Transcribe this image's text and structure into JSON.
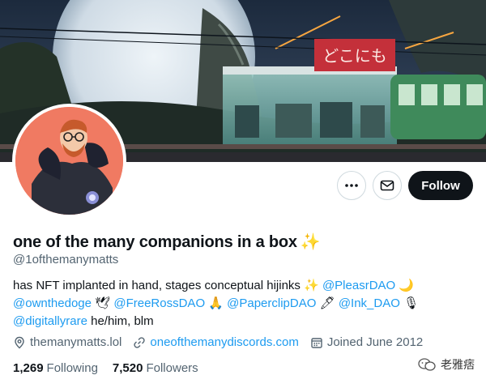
{
  "profile": {
    "display_name": "one of the many companions in a box",
    "name_emoji": "✨",
    "handle": "@1ofthemanymatts"
  },
  "actions": {
    "more_label": "More",
    "message_label": "Message",
    "follow_label": "Follow"
  },
  "banner": {
    "sign_text": "どこにも"
  },
  "bio": {
    "segments": [
      {
        "type": "text",
        "text": "has NFT implanted in hand, stages conceptual hijinks "
      },
      {
        "type": "emoji",
        "text": "✨"
      },
      {
        "type": "text",
        "text": " "
      },
      {
        "type": "mention",
        "text": "@PleasrDAO"
      },
      {
        "type": "text",
        "text": " "
      },
      {
        "type": "emoji",
        "text": "🌙"
      },
      {
        "type": "text",
        "text": " "
      },
      {
        "type": "mention",
        "text": "@ownthedoge"
      },
      {
        "type": "text",
        "text": " "
      },
      {
        "type": "emoji",
        "text": "🕊"
      },
      {
        "type": "text",
        "text": " "
      },
      {
        "type": "mention",
        "text": "@FreeRossDAO"
      },
      {
        "type": "text",
        "text": " "
      },
      {
        "type": "emoji",
        "text": "🙏"
      },
      {
        "type": "text",
        "text": " "
      },
      {
        "type": "mention",
        "text": "@PaperclipDAO"
      },
      {
        "type": "text",
        "text": " "
      },
      {
        "type": "emoji",
        "text": "🖊"
      },
      {
        "type": "text",
        "text": " "
      },
      {
        "type": "mention",
        "text": "@Ink_DAO"
      },
      {
        "type": "text",
        "text": " "
      },
      {
        "type": "emoji",
        "text": "🎙"
      },
      {
        "type": "text",
        "text": " "
      },
      {
        "type": "mention",
        "text": "@digitallyrare"
      },
      {
        "type": "text",
        "text": " he/him, blm"
      }
    ]
  },
  "meta": {
    "location": "themanymatts.lol",
    "website": "oneofthemanydiscords.com",
    "joined": "Joined June 2012"
  },
  "stats": {
    "following_count": "1,269",
    "following_label": "Following",
    "followers_count": "7,520",
    "followers_label": "Followers"
  },
  "watermark": {
    "text": "老雅痞"
  },
  "colors": {
    "accent": "#1d9bf0",
    "text": "#0f1419",
    "secondary": "#536471",
    "follow_bg": "#0f1419",
    "avatar_bg": "#f07a62"
  }
}
